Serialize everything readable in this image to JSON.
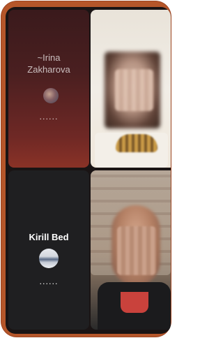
{
  "participants": [
    {
      "id": "p1",
      "display_name": "~Irina Zakharova",
      "status_indicator": "......",
      "avatar_icon": "profile-photo"
    },
    {
      "id": "p2",
      "display_name": "Kirill Bed",
      "status_indicator": "......",
      "avatar_icon": "profile-photo"
    }
  ],
  "video_feeds": [
    {
      "id": "v1",
      "state": "blurred"
    },
    {
      "id": "v2",
      "state": "blurred"
    }
  ],
  "colors": {
    "frame_accent": "#b5562a",
    "call_background": "#1a1414",
    "tile_irina": "#5a2423",
    "tile_kirill": "#1f1f21",
    "text": "#ffffff"
  }
}
